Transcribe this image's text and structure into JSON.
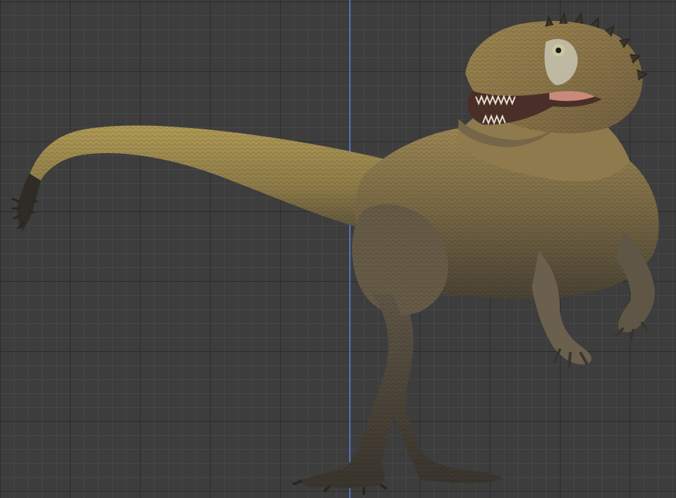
{
  "viewport": {
    "background_color": "#3d3d3d",
    "grid_minor_color": "#474747",
    "grid_major_color": "#2c2c2c",
    "axis_color": "#5a7fd6"
  },
  "model": {
    "subject": "theropod-dinosaur-3d-model",
    "skin_color_back": "#a08a4c",
    "skin_color_belly": "#5d5442",
    "skin_color_dark": "#3a3328",
    "eye_color": "#c8c9a0",
    "mouth_color": "#c98a7c"
  }
}
